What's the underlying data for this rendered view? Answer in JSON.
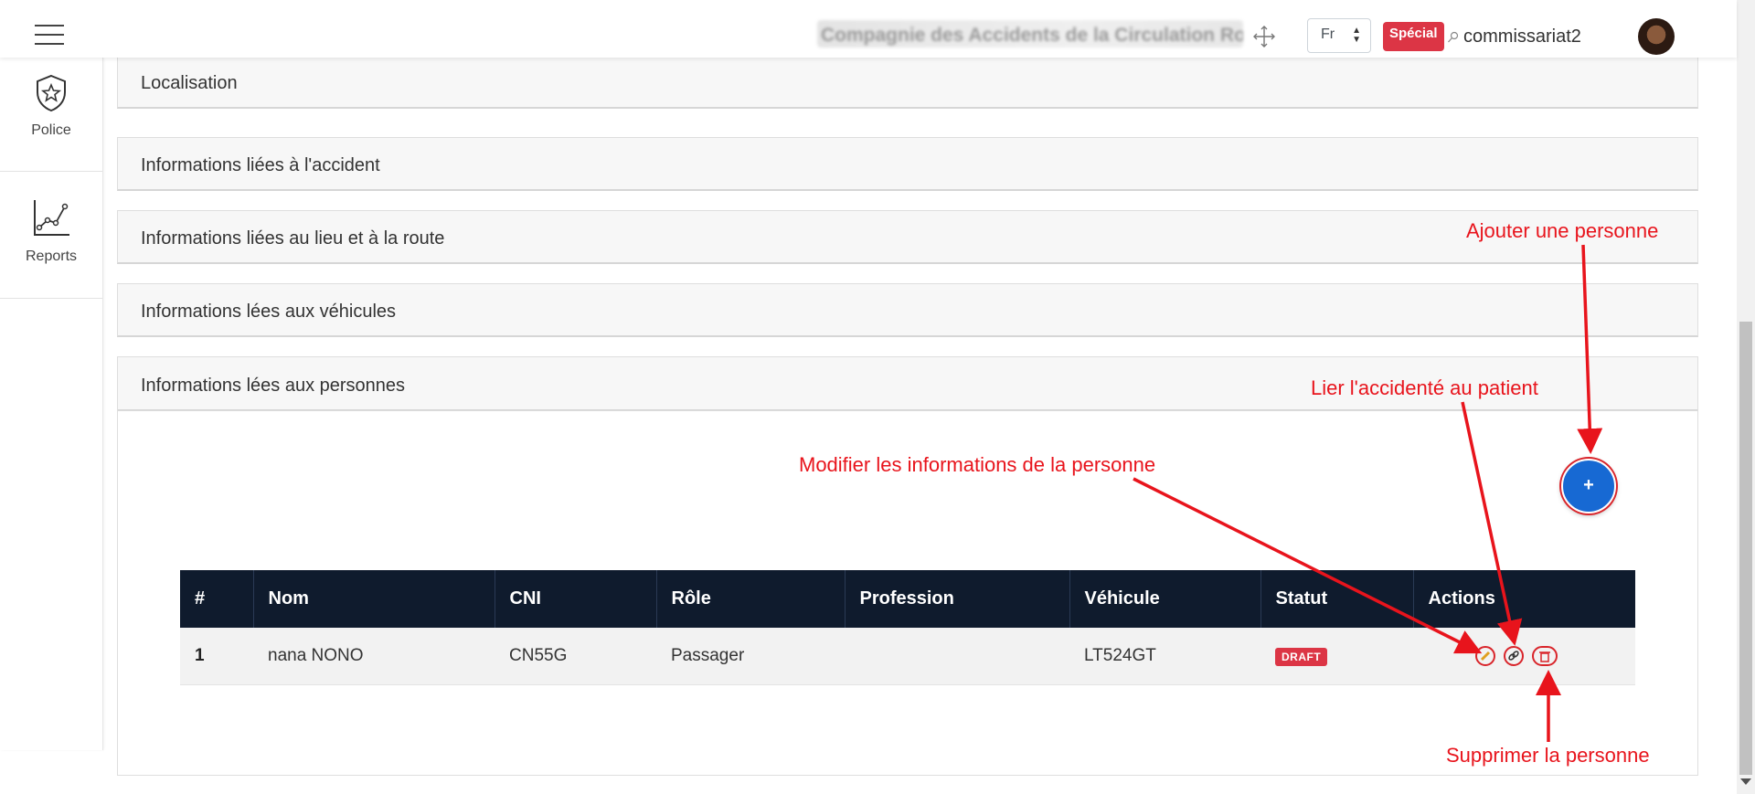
{
  "header": {
    "company": "Compagnie des Accidents de la Circulation Routière",
    "language": "Fr",
    "badge": "Spécial",
    "username": "commissariat2"
  },
  "sidebar": {
    "items": [
      {
        "label": "Police",
        "icon": "police-badge-icon"
      },
      {
        "label": "Reports",
        "icon": "chart-line-icon"
      }
    ]
  },
  "panels": [
    {
      "title": "Localisation"
    },
    {
      "title": "Informations liées à l'accident"
    },
    {
      "title": "Informations liées au lieu et à la route"
    },
    {
      "title": "Informations lées aux véhicules"
    },
    {
      "title": "Informations lées aux personnes"
    }
  ],
  "add_button": {
    "label": "+"
  },
  "table": {
    "columns": [
      "#",
      "Nom",
      "CNI",
      "Rôle",
      "Profession",
      "Véhicule",
      "Statut",
      "Actions"
    ],
    "rows": [
      {
        "num": "1",
        "nom": "nana NONO",
        "cni": "CN55G",
        "role": "Passager",
        "profession": "",
        "vehicule": "LT524GT",
        "statut": "DRAFT"
      }
    ]
  },
  "annotations": {
    "add": "Ajouter une personne",
    "link": "Lier l'accidenté au patient",
    "edit": "Modifier les informations de la personne",
    "delete": "Supprimer la personne"
  },
  "colors": {
    "accent": "#1769d3",
    "danger": "#dc3545",
    "annotation": "#e8141c",
    "table_header": "#0f1b2d"
  }
}
